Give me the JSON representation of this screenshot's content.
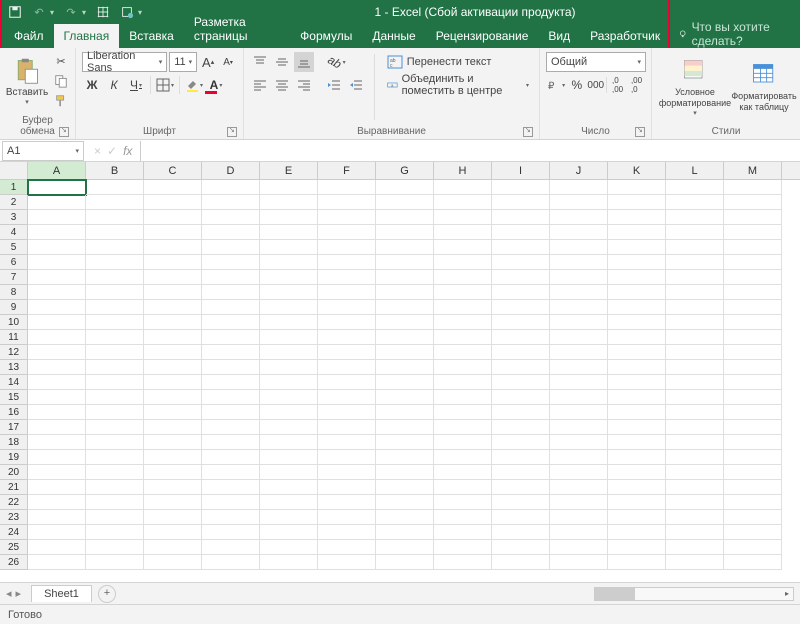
{
  "title": "1 - Excel (Сбой активации продукта)",
  "tabs": [
    "Файл",
    "Главная",
    "Вставка",
    "Разметка страницы",
    "Формулы",
    "Данные",
    "Рецензирование",
    "Вид",
    "Разработчик"
  ],
  "active_tab": 1,
  "tellme": "Что вы хотите сделать?",
  "ribbon": {
    "clipboard": {
      "paste": "Вставить",
      "label": "Буфер обмена"
    },
    "font": {
      "name": "Liberation Sans",
      "size": "11",
      "bold": "Ж",
      "italic": "К",
      "underline": "Ч",
      "label": "Шрифт"
    },
    "align": {
      "wrap": "Перенести текст",
      "merge": "Объединить и поместить в центре",
      "label": "Выравнивание"
    },
    "number": {
      "format": "Общий",
      "label": "Число"
    },
    "styles": {
      "cond": "Условное форматирование",
      "table": "Форматировать как таблицу",
      "label": "Стили"
    }
  },
  "namebox": "A1",
  "columns": [
    "A",
    "B",
    "C",
    "D",
    "E",
    "F",
    "G",
    "H",
    "I",
    "J",
    "K",
    "L",
    "M"
  ],
  "rows": 26,
  "active_cell": {
    "r": 1,
    "c": 0
  },
  "sheet": "Sheet1",
  "status": "Готово"
}
